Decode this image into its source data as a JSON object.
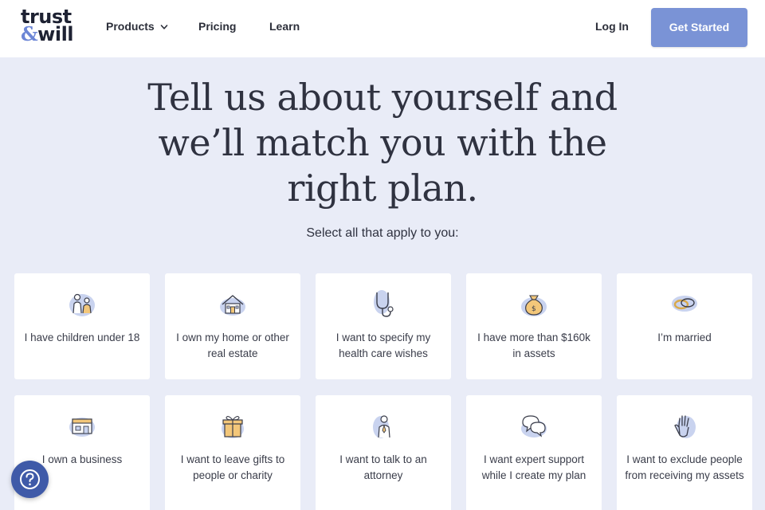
{
  "brand": {
    "line1": "trust",
    "amp": "&",
    "line2": "will"
  },
  "nav": {
    "products": "Products",
    "pricing": "Pricing",
    "learn": "Learn",
    "login": "Log In",
    "cta": "Get Started"
  },
  "hero": {
    "headline": "Tell us about yourself and we’ll match you with the right plan.",
    "subhead": "Select all that apply to you:"
  },
  "options": [
    {
      "label": "I have children under 18",
      "icon": "family-icon"
    },
    {
      "label": "I own my home or other real estate",
      "icon": "house-icon"
    },
    {
      "label": "I want to specify my health care wishes",
      "icon": "stethoscope-icon"
    },
    {
      "label": "I have more than $160k in assets",
      "icon": "money-bag-icon"
    },
    {
      "label": "I’m married",
      "icon": "rings-icon"
    },
    {
      "label": "I own a business",
      "icon": "storefront-icon"
    },
    {
      "label": "I want to leave gifts to people or charity",
      "icon": "gift-icon"
    },
    {
      "label": "I want to talk to an attorney",
      "icon": "attorney-icon"
    },
    {
      "label": "I want expert support while I create my plan",
      "icon": "chat-bubbles-icon"
    },
    {
      "label": "I want to exclude people from receiving my assets",
      "icon": "raised-hand-icon"
    }
  ],
  "colors": {
    "accent": "#7a93d6",
    "background": "#e9ecf7",
    "help_button": "#3f5aa8"
  }
}
